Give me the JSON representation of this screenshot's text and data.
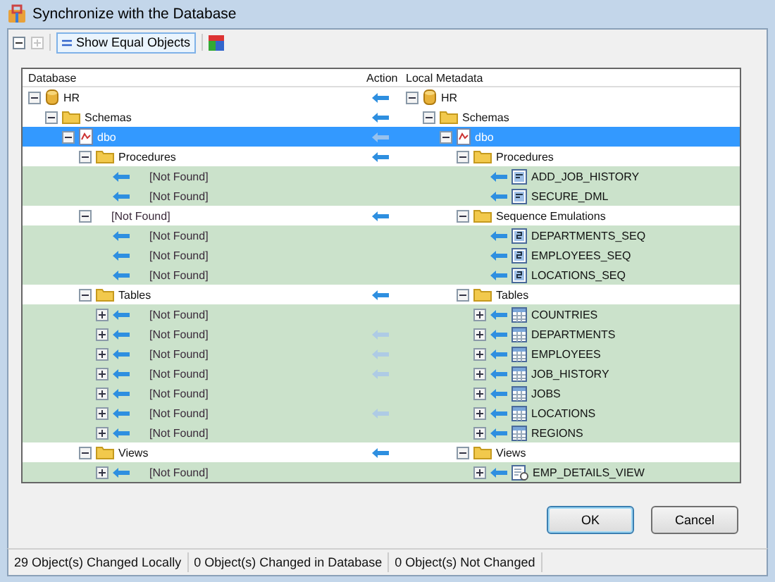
{
  "window": {
    "title": "Synchronize with the Database"
  },
  "toolbar": {
    "show_equal_objects": {
      "label": "Show Equal Objects",
      "on": true
    }
  },
  "columns": {
    "left": "Database",
    "action": "Action",
    "right": "Local Metadata"
  },
  "rows": [
    {
      "selected": false,
      "push": true,
      "dim": false,
      "left": {
        "kind": "database",
        "label": "HR",
        "expanded": true
      },
      "right": {
        "kind": "database",
        "label": "HR",
        "expanded": true
      },
      "children": [
        {
          "selected": false,
          "push": true,
          "dim": false,
          "left": {
            "kind": "folder",
            "label": "Schemas",
            "expanded": true
          },
          "right": {
            "kind": "folder",
            "label": "Schemas",
            "expanded": true
          },
          "children": [
            {
              "selected": true,
              "push": true,
              "dim": true,
              "left": {
                "kind": "schema",
                "label": "dbo",
                "expanded": true
              },
              "right": {
                "kind": "schema",
                "label": "dbo",
                "expanded": true
              },
              "children": [
                {
                  "selected": false,
                  "push": true,
                  "dim": false,
                  "left": {
                    "kind": "folder",
                    "label": "Procedures",
                    "expanded": true
                  },
                  "right": {
                    "kind": "folder",
                    "label": "Procedures",
                    "expanded": true
                  },
                  "children": [
                    {
                      "selected": false,
                      "push": false,
                      "left": {
                        "kind": "missing",
                        "label": "[Not Found]",
                        "arrow": true
                      },
                      "right": {
                        "kind": "procedure",
                        "label": "ADD_JOB_HISTORY",
                        "arrow": true
                      }
                    },
                    {
                      "selected": false,
                      "push": false,
                      "left": {
                        "kind": "missing",
                        "label": "[Not Found]",
                        "arrow": true
                      },
                      "right": {
                        "kind": "procedure",
                        "label": "SECURE_DML",
                        "arrow": true
                      }
                    }
                  ]
                },
                {
                  "selected": false,
                  "push": true,
                  "dim": false,
                  "left": {
                    "kind": "missing",
                    "label": "[Not Found]",
                    "expanded": true
                  },
                  "right": {
                    "kind": "folder",
                    "label": "Sequence Emulations",
                    "expanded": true
                  },
                  "children": [
                    {
                      "selected": false,
                      "push": false,
                      "left": {
                        "kind": "missing",
                        "label": "[Not Found]",
                        "arrow": true
                      },
                      "right": {
                        "kind": "sequence",
                        "label": "DEPARTMENTS_SEQ",
                        "arrow": true
                      }
                    },
                    {
                      "selected": false,
                      "push": false,
                      "left": {
                        "kind": "missing",
                        "label": "[Not Found]",
                        "arrow": true
                      },
                      "right": {
                        "kind": "sequence",
                        "label": "EMPLOYEES_SEQ",
                        "arrow": true
                      }
                    },
                    {
                      "selected": false,
                      "push": false,
                      "left": {
                        "kind": "missing",
                        "label": "[Not Found]",
                        "arrow": true
                      },
                      "right": {
                        "kind": "sequence",
                        "label": "LOCATIONS_SEQ",
                        "arrow": true
                      }
                    }
                  ]
                },
                {
                  "selected": false,
                  "push": true,
                  "dim": false,
                  "left": {
                    "kind": "folder",
                    "label": "Tables",
                    "expanded": true
                  },
                  "right": {
                    "kind": "folder",
                    "label": "Tables",
                    "expanded": true
                  },
                  "children": [
                    {
                      "selected": false,
                      "push": false,
                      "left": {
                        "kind": "missing",
                        "label": "[Not Found]",
                        "arrow": true,
                        "expanded": false
                      },
                      "right": {
                        "kind": "table",
                        "label": "COUNTRIES",
                        "arrow": true,
                        "expanded": false
                      }
                    },
                    {
                      "selected": false,
                      "push": true,
                      "dim": true,
                      "left": {
                        "kind": "missing",
                        "label": "[Not Found]",
                        "arrow": true,
                        "expanded": false
                      },
                      "right": {
                        "kind": "table",
                        "label": "DEPARTMENTS",
                        "arrow": true,
                        "expanded": false
                      }
                    },
                    {
                      "selected": false,
                      "push": true,
                      "dim": true,
                      "left": {
                        "kind": "missing",
                        "label": "[Not Found]",
                        "arrow": true,
                        "expanded": false
                      },
                      "right": {
                        "kind": "table",
                        "label": "EMPLOYEES",
                        "arrow": true,
                        "expanded": false
                      }
                    },
                    {
                      "selected": false,
                      "push": true,
                      "dim": true,
                      "left": {
                        "kind": "missing",
                        "label": "[Not Found]",
                        "arrow": true,
                        "expanded": false
                      },
                      "right": {
                        "kind": "table",
                        "label": "JOB_HISTORY",
                        "arrow": true,
                        "expanded": false
                      }
                    },
                    {
                      "selected": false,
                      "push": false,
                      "left": {
                        "kind": "missing",
                        "label": "[Not Found]",
                        "arrow": true,
                        "expanded": false
                      },
                      "right": {
                        "kind": "table",
                        "label": "JOBS",
                        "arrow": true,
                        "expanded": false
                      }
                    },
                    {
                      "selected": false,
                      "push": true,
                      "dim": true,
                      "left": {
                        "kind": "missing",
                        "label": "[Not Found]",
                        "arrow": true,
                        "expanded": false
                      },
                      "right": {
                        "kind": "table",
                        "label": "LOCATIONS",
                        "arrow": true,
                        "expanded": false
                      }
                    },
                    {
                      "selected": false,
                      "push": false,
                      "left": {
                        "kind": "missing",
                        "label": "[Not Found]",
                        "arrow": true,
                        "expanded": false
                      },
                      "right": {
                        "kind": "table",
                        "label": "REGIONS",
                        "arrow": true,
                        "expanded": false
                      }
                    }
                  ]
                },
                {
                  "selected": false,
                  "push": true,
                  "dim": false,
                  "left": {
                    "kind": "folder",
                    "label": "Views",
                    "expanded": true
                  },
                  "right": {
                    "kind": "folder",
                    "label": "Views",
                    "expanded": true
                  },
                  "children": [
                    {
                      "selected": false,
                      "push": false,
                      "left": {
                        "kind": "missing",
                        "label": "[Not Found]",
                        "arrow": true,
                        "expanded": false
                      },
                      "right": {
                        "kind": "view",
                        "label": "EMP_DETAILS_VIEW",
                        "arrow": true,
                        "expanded": false
                      }
                    }
                  ]
                }
              ]
            }
          ]
        }
      ]
    }
  ],
  "buttons": [
    {
      "label": "OK",
      "default": true
    },
    {
      "label": "Cancel",
      "default": false
    }
  ],
  "status_bar": [
    "29 Object(s) Changed Locally",
    "0 Object(s) Changed in Database",
    "0 Object(s) Not Changed"
  ]
}
